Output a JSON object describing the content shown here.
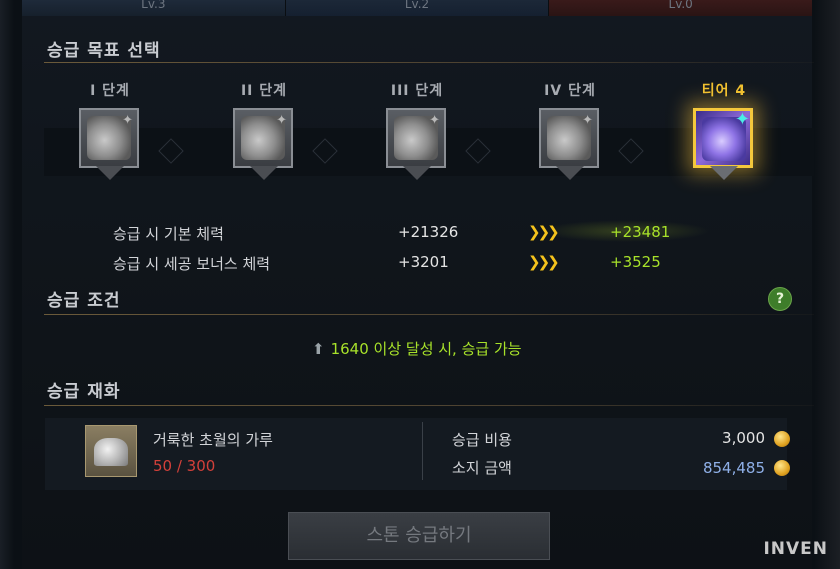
{
  "top_strip": {
    "icon": "lotus-icon",
    "levels": [
      "Lv.3",
      "Lv.2",
      "Lv.0"
    ]
  },
  "promotion_target": {
    "title": "승급 목표 선택",
    "tiers": [
      {
        "label": "I 단계",
        "icon": "gray-stone-icon"
      },
      {
        "label": "II 단계",
        "icon": "gray-stone-icon"
      },
      {
        "label": "III 단계",
        "icon": "gray-stone-icon"
      },
      {
        "label": "IV 단계",
        "icon": "gray-stone-icon"
      },
      {
        "label": "티어 4",
        "icon": "purple-stone-icon",
        "selected": true
      }
    ],
    "stats": [
      {
        "label": "승급 시 기본 체력",
        "current": "+21326",
        "arrow": "❯❯❯",
        "next": "+23481"
      },
      {
        "label": "승급 시 세공 보너스 체력",
        "current": "+3201",
        "arrow": "❯❯❯",
        "next": "+3525"
      }
    ]
  },
  "promotion_condition": {
    "title": "승급 조건",
    "help_label": "?",
    "condition_icon": "gear-level-icon",
    "condition_text": "1640 이상 달성 시, 승급 가능"
  },
  "promotion_material": {
    "title": "승급 재화",
    "item_name": "거룩한 초월의 가루",
    "item_count": "50 / 300",
    "cost_label": "승급 비용",
    "cost_value": "3,000",
    "owned_label": "소지 금액",
    "owned_value": "854,485",
    "currency_icon": "gold-coin-icon",
    "colors": {
      "owned": "#8fb0e8",
      "cost": "#e4e4e4",
      "insufficient": "#d2403a"
    }
  },
  "action_button": "스톤 승급하기",
  "watermark": "INVEN"
}
